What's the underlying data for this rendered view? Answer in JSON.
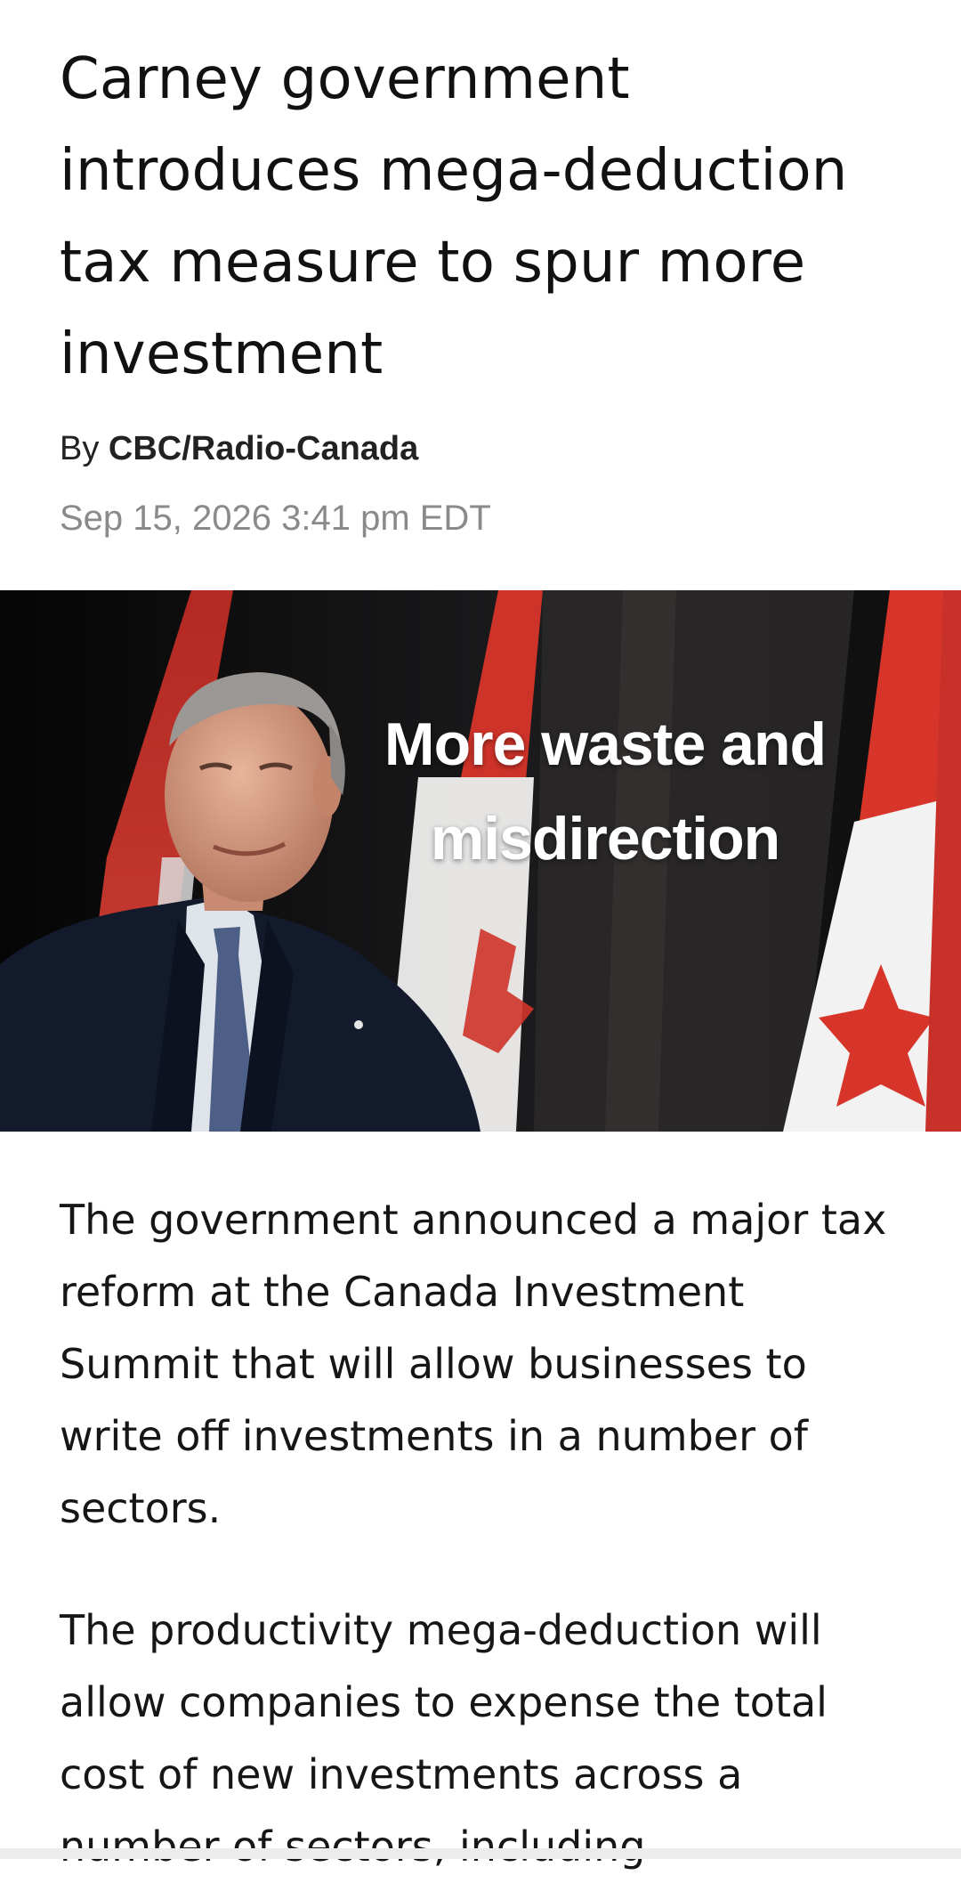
{
  "article": {
    "headline": "Carney government introduces mega-deduction tax measure to spur more investment",
    "byline_prefix": "By ",
    "author": "CBC/Radio-Canada",
    "date": "Sep 15, 2026 3:41 pm EDT",
    "hero_image": {
      "overlay_line1": "More waste and",
      "overlay_line2": "misdirection"
    },
    "paragraphs": [
      "The government announced a major tax reform at the Canada Investment Summit that will allow businesses to write off investments in a number of sectors.",
      "The productivity mega-deduction will allow companies to expense the total cost of new investments across a number of sectors, including"
    ]
  },
  "colors": {
    "flag_red": "#d8352a",
    "flag_white": "#f2f2f2",
    "dateline_gray": "#8a8a8a"
  }
}
